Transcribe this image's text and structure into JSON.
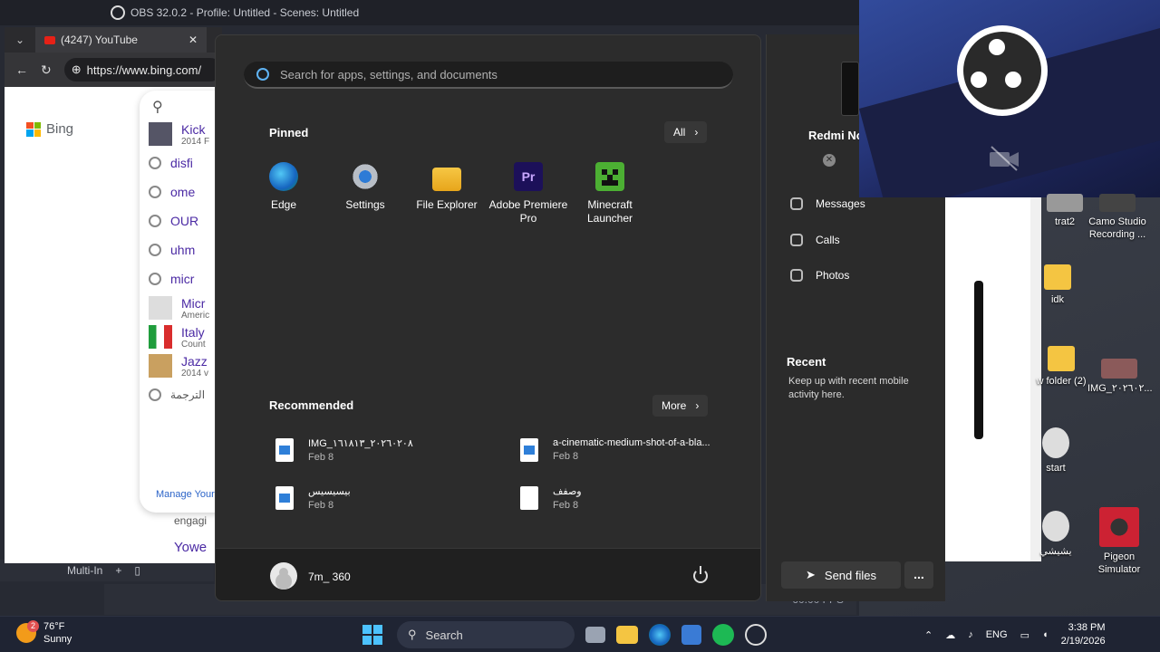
{
  "obs": {
    "window_title": "OBS 32.0.2 - Profile: Untitled - Scenes: Untitled",
    "status": "60.00 FPS",
    "multi_label": "Multi-In"
  },
  "browser": {
    "tab_title": "(4247) YouTube",
    "url": "https://www.bing.com/",
    "bing_label": "Bing",
    "suggestions": [
      {
        "text": "Kick",
        "sub": "2014 F"
      },
      {
        "text": "disfi",
        "sub": ""
      },
      {
        "text": "ome",
        "sub": ""
      },
      {
        "text": "OUR",
        "sub": ""
      },
      {
        "text": "uhm",
        "sub": ""
      },
      {
        "text": "micr",
        "sub": ""
      },
      {
        "text": "Micr",
        "sub": "Americ"
      },
      {
        "text": "Italy",
        "sub": "Count"
      },
      {
        "text": "Jazz",
        "sub": "2014 v"
      },
      {
        "text": "الترجمة",
        "sub": ""
      }
    ],
    "manage_label": "Manage Your",
    "engaging_text": "engagi",
    "yowe_text": "Yowe"
  },
  "start_menu": {
    "search_placeholder": "Search for apps, settings, and documents",
    "pinned_title": "Pinned",
    "all_label": "All",
    "pinned": [
      {
        "label": "Edge",
        "icon": "edge-icon"
      },
      {
        "label": "Settings",
        "icon": "settings-icon"
      },
      {
        "label": "File Explorer",
        "icon": "folder-icon"
      },
      {
        "label": "Adobe Premiere Pro",
        "icon": "premiere-icon"
      },
      {
        "label": "Minecraft Launcher",
        "icon": "minecraft-icon"
      }
    ],
    "premiere_glyph": "Pr",
    "recommended_title": "Recommended",
    "more_label": "More",
    "recommended": [
      {
        "name": "IMG_٢٠٢٦٠٢٠٨_١٦١٨١٣",
        "date": "Feb 8",
        "type": "image"
      },
      {
        "name": "a-cinematic-medium-shot-of-a-bla...",
        "date": "Feb 8",
        "type": "image"
      },
      {
        "name": "بيسيسيس",
        "date": "Feb 8",
        "type": "image"
      },
      {
        "name": "وصفف",
        "date": "Feb 8",
        "type": "doc"
      }
    ],
    "user_name": "7m_ 360"
  },
  "phone_link": {
    "device_name": "Redmi No",
    "nav": [
      "Messages",
      "Calls",
      "Photos"
    ],
    "recent_title": "Recent",
    "recent_text": "Keep up with recent mobile activity here.",
    "send_files_label": "Send files",
    "more_glyph": "..."
  },
  "desktop_icons": [
    {
      "label": "trat2"
    },
    {
      "label": "Camo Studio Recording ..."
    },
    {
      "label": "idk"
    },
    {
      "label": "w folder (2)"
    },
    {
      "label": "IMG_٢٠٢٦٠٢..."
    },
    {
      "label": "start"
    },
    {
      "label": "يشيشي"
    },
    {
      "label": "Pigeon Simulator"
    }
  ],
  "taskbar": {
    "temperature": "76°F",
    "weather": "Sunny",
    "badge": "2",
    "search_label": "Search",
    "language": "ENG",
    "time": "3:38 PM",
    "date": "2/19/2026"
  },
  "colors": {
    "start_bg": "#2c2c2c",
    "accent": "#4cc2ff",
    "obs_overlay": "#26367a"
  }
}
